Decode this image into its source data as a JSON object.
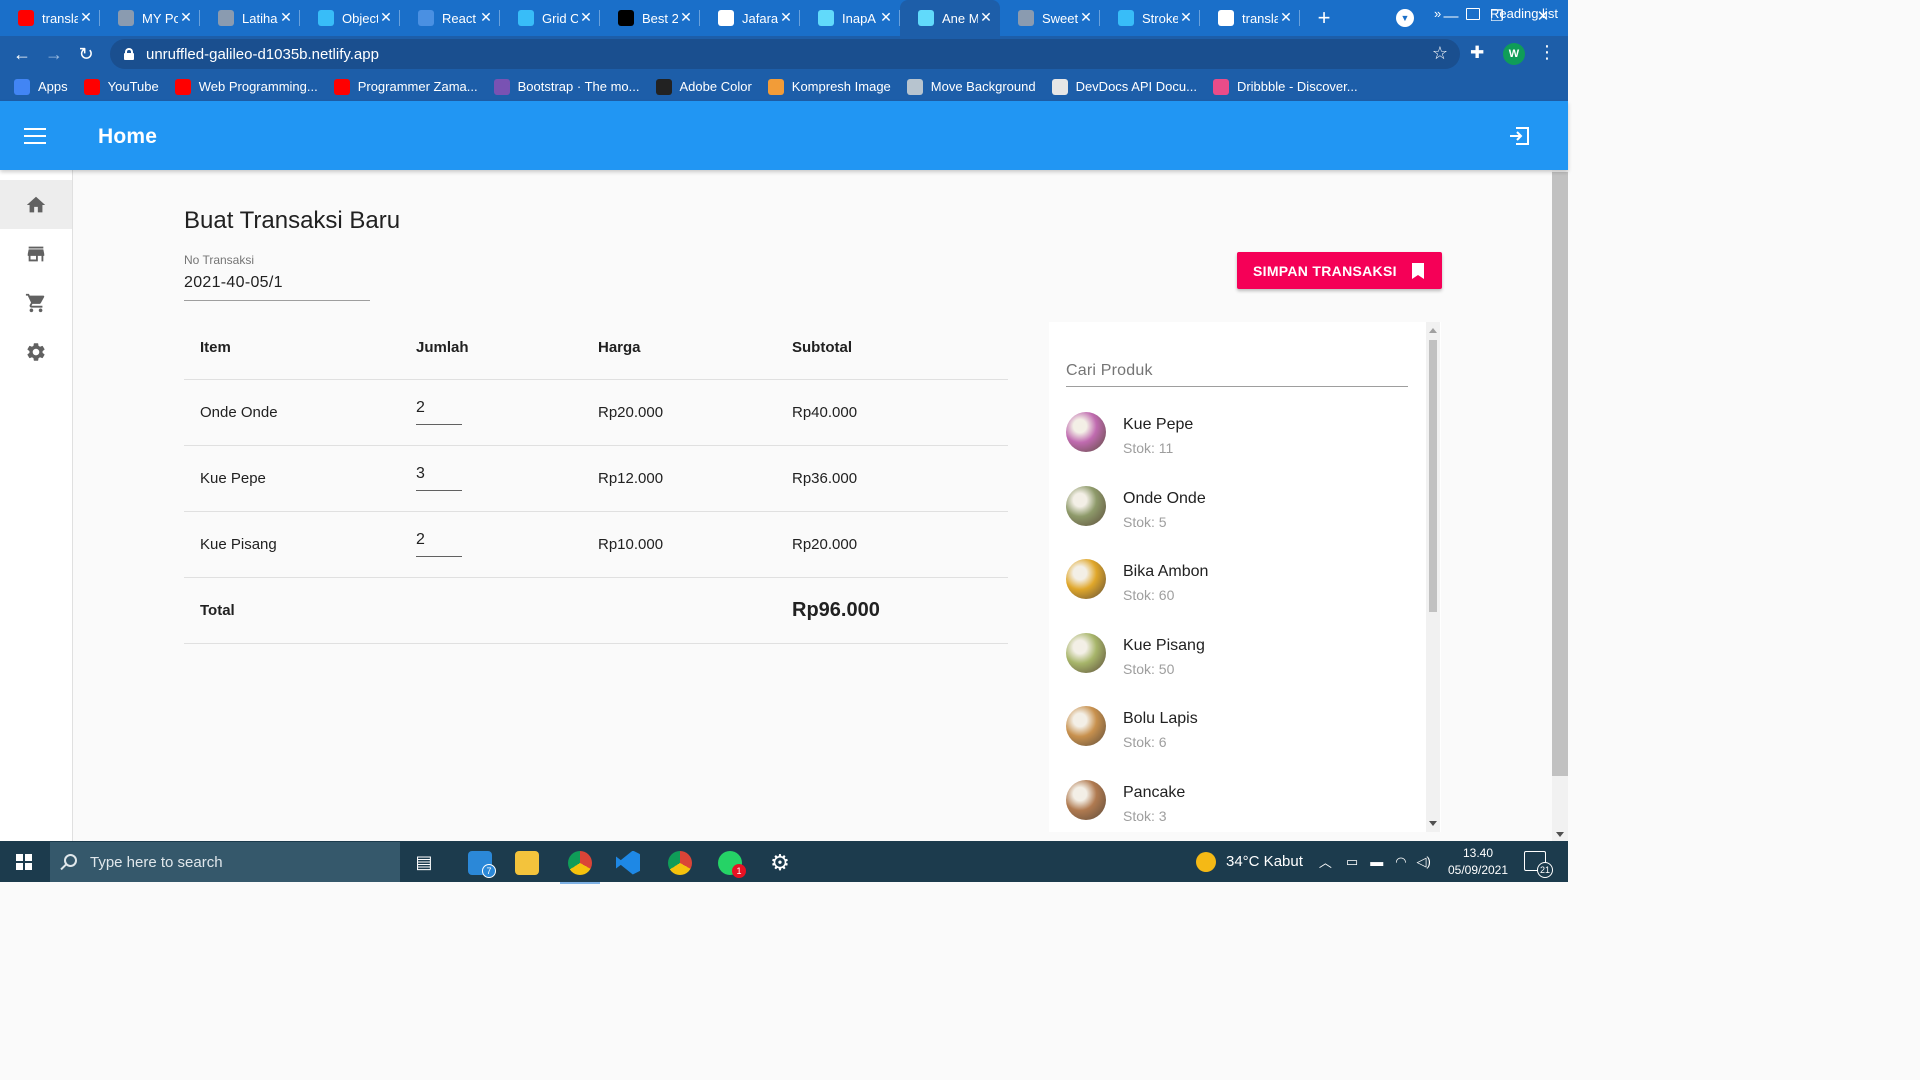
{
  "browser": {
    "tabs": [
      {
        "label": "transla",
        "icon": "youtube-icon",
        "color": "#ff0000"
      },
      {
        "label": "MY Po",
        "icon": "globe-icon",
        "color": "#8a9bb0"
      },
      {
        "label": "Latiha",
        "icon": "globe-icon",
        "color": "#8a9bb0"
      },
      {
        "label": "Object",
        "icon": "tailwind-icon",
        "color": "#38bdf8"
      },
      {
        "label": "React",
        "icon": "flag-icon",
        "color": "#4a90e2"
      },
      {
        "label": "Grid C",
        "icon": "tailwind-icon",
        "color": "#38bdf8"
      },
      {
        "label": "Best 2",
        "icon": "dev-icon",
        "color": "#000000"
      },
      {
        "label": "Jafara",
        "icon": "github-icon",
        "color": "#ffffff"
      },
      {
        "label": "InapA",
        "icon": "react-icon",
        "color": "#61dafb"
      },
      {
        "label": "Ane M",
        "icon": "react-icon",
        "color": "#61dafb",
        "active": true
      },
      {
        "label": "Sweet",
        "icon": "globe-icon",
        "color": "#8a9bb0"
      },
      {
        "label": "Stroke",
        "icon": "tailwind-icon",
        "color": "#38bdf8"
      },
      {
        "label": "transla",
        "icon": "google-icon",
        "color": "#ffffff"
      }
    ],
    "url": "unruffled-galileo-d1035b.netlify.app",
    "profile_initial": "W",
    "bookmarks": [
      {
        "label": "Apps",
        "icon": "apps-grid-icon",
        "color": "#4285f4"
      },
      {
        "label": "YouTube",
        "icon": "youtube-icon",
        "color": "#ff0000"
      },
      {
        "label": "Web Programming...",
        "icon": "youtube-icon",
        "color": "#ff0000"
      },
      {
        "label": "Programmer Zama...",
        "icon": "youtube-icon",
        "color": "#ff0000"
      },
      {
        "label": "Bootstrap · The mo...",
        "icon": "bootstrap-icon",
        "color": "#7952b3"
      },
      {
        "label": "Adobe Color",
        "icon": "adobe-color-icon",
        "color": "#222222"
      },
      {
        "label": "Kompresh Image",
        "icon": "compress-icon",
        "color": "#f29c38"
      },
      {
        "label": "Move Background",
        "icon": "remove-bg-icon",
        "color": "#b7c4cf"
      },
      {
        "label": "DevDocs API Docu...",
        "icon": "devdocs-icon",
        "color": "#e6e6e6"
      },
      {
        "label": "Dribbble - Discover...",
        "icon": "dribbble-icon",
        "color": "#ea4c89"
      }
    ],
    "bookmarks_more": "»",
    "reading_list": "Reading list"
  },
  "app": {
    "title": "Home",
    "accent": "#2196f3",
    "nav": [
      {
        "name": "home",
        "icon": "home-icon",
        "active": true
      },
      {
        "name": "store",
        "icon": "store-icon"
      },
      {
        "name": "cart",
        "icon": "cart-icon"
      },
      {
        "name": "settings",
        "icon": "gear-icon"
      }
    ]
  },
  "page": {
    "title": "Buat Transaksi Baru",
    "no_transaksi_label": "No Transaksi",
    "no_transaksi_value": "2021-40-05/1",
    "save_button": "SIMPAN TRANSAKSI",
    "save_color": "#f50057"
  },
  "table": {
    "headers": [
      "Item",
      "Jumlah",
      "Harga",
      "Subtotal"
    ],
    "rows": [
      {
        "item": "Onde Onde",
        "qty": "2",
        "price": "Rp20.000",
        "subtotal": "Rp40.000"
      },
      {
        "item": "Kue Pepe",
        "qty": "3",
        "price": "Rp12.000",
        "subtotal": "Rp36.000"
      },
      {
        "item": "Kue Pisang",
        "qty": "2",
        "price": "Rp10.000",
        "subtotal": "Rp20.000"
      }
    ],
    "total_label": "Total",
    "total_value": "Rp96.000"
  },
  "products": {
    "search_placeholder": "Cari Produk",
    "items": [
      {
        "name": "Kue Pepe",
        "stock": "Stok: 11",
        "color": "#c06bb0"
      },
      {
        "name": "Onde Onde",
        "stock": "Stok: 5",
        "color": "#8e9a6a"
      },
      {
        "name": "Bika Ambon",
        "stock": "Stok: 60",
        "color": "#e0a72a"
      },
      {
        "name": "Kue Pisang",
        "stock": "Stok: 50",
        "color": "#a7b56a"
      },
      {
        "name": "Bolu Lapis",
        "stock": "Stok: 6",
        "color": "#c8914e"
      },
      {
        "name": "Pancake",
        "stock": "Stok: 3",
        "color": "#b07a50"
      }
    ]
  },
  "taskbar": {
    "search_placeholder": "Type here to search",
    "mail_badge": "7",
    "whatsapp_badge": "1",
    "weather": "34°C  Kabut",
    "time": "13.40",
    "date": "05/09/2021",
    "notifications": "21"
  }
}
